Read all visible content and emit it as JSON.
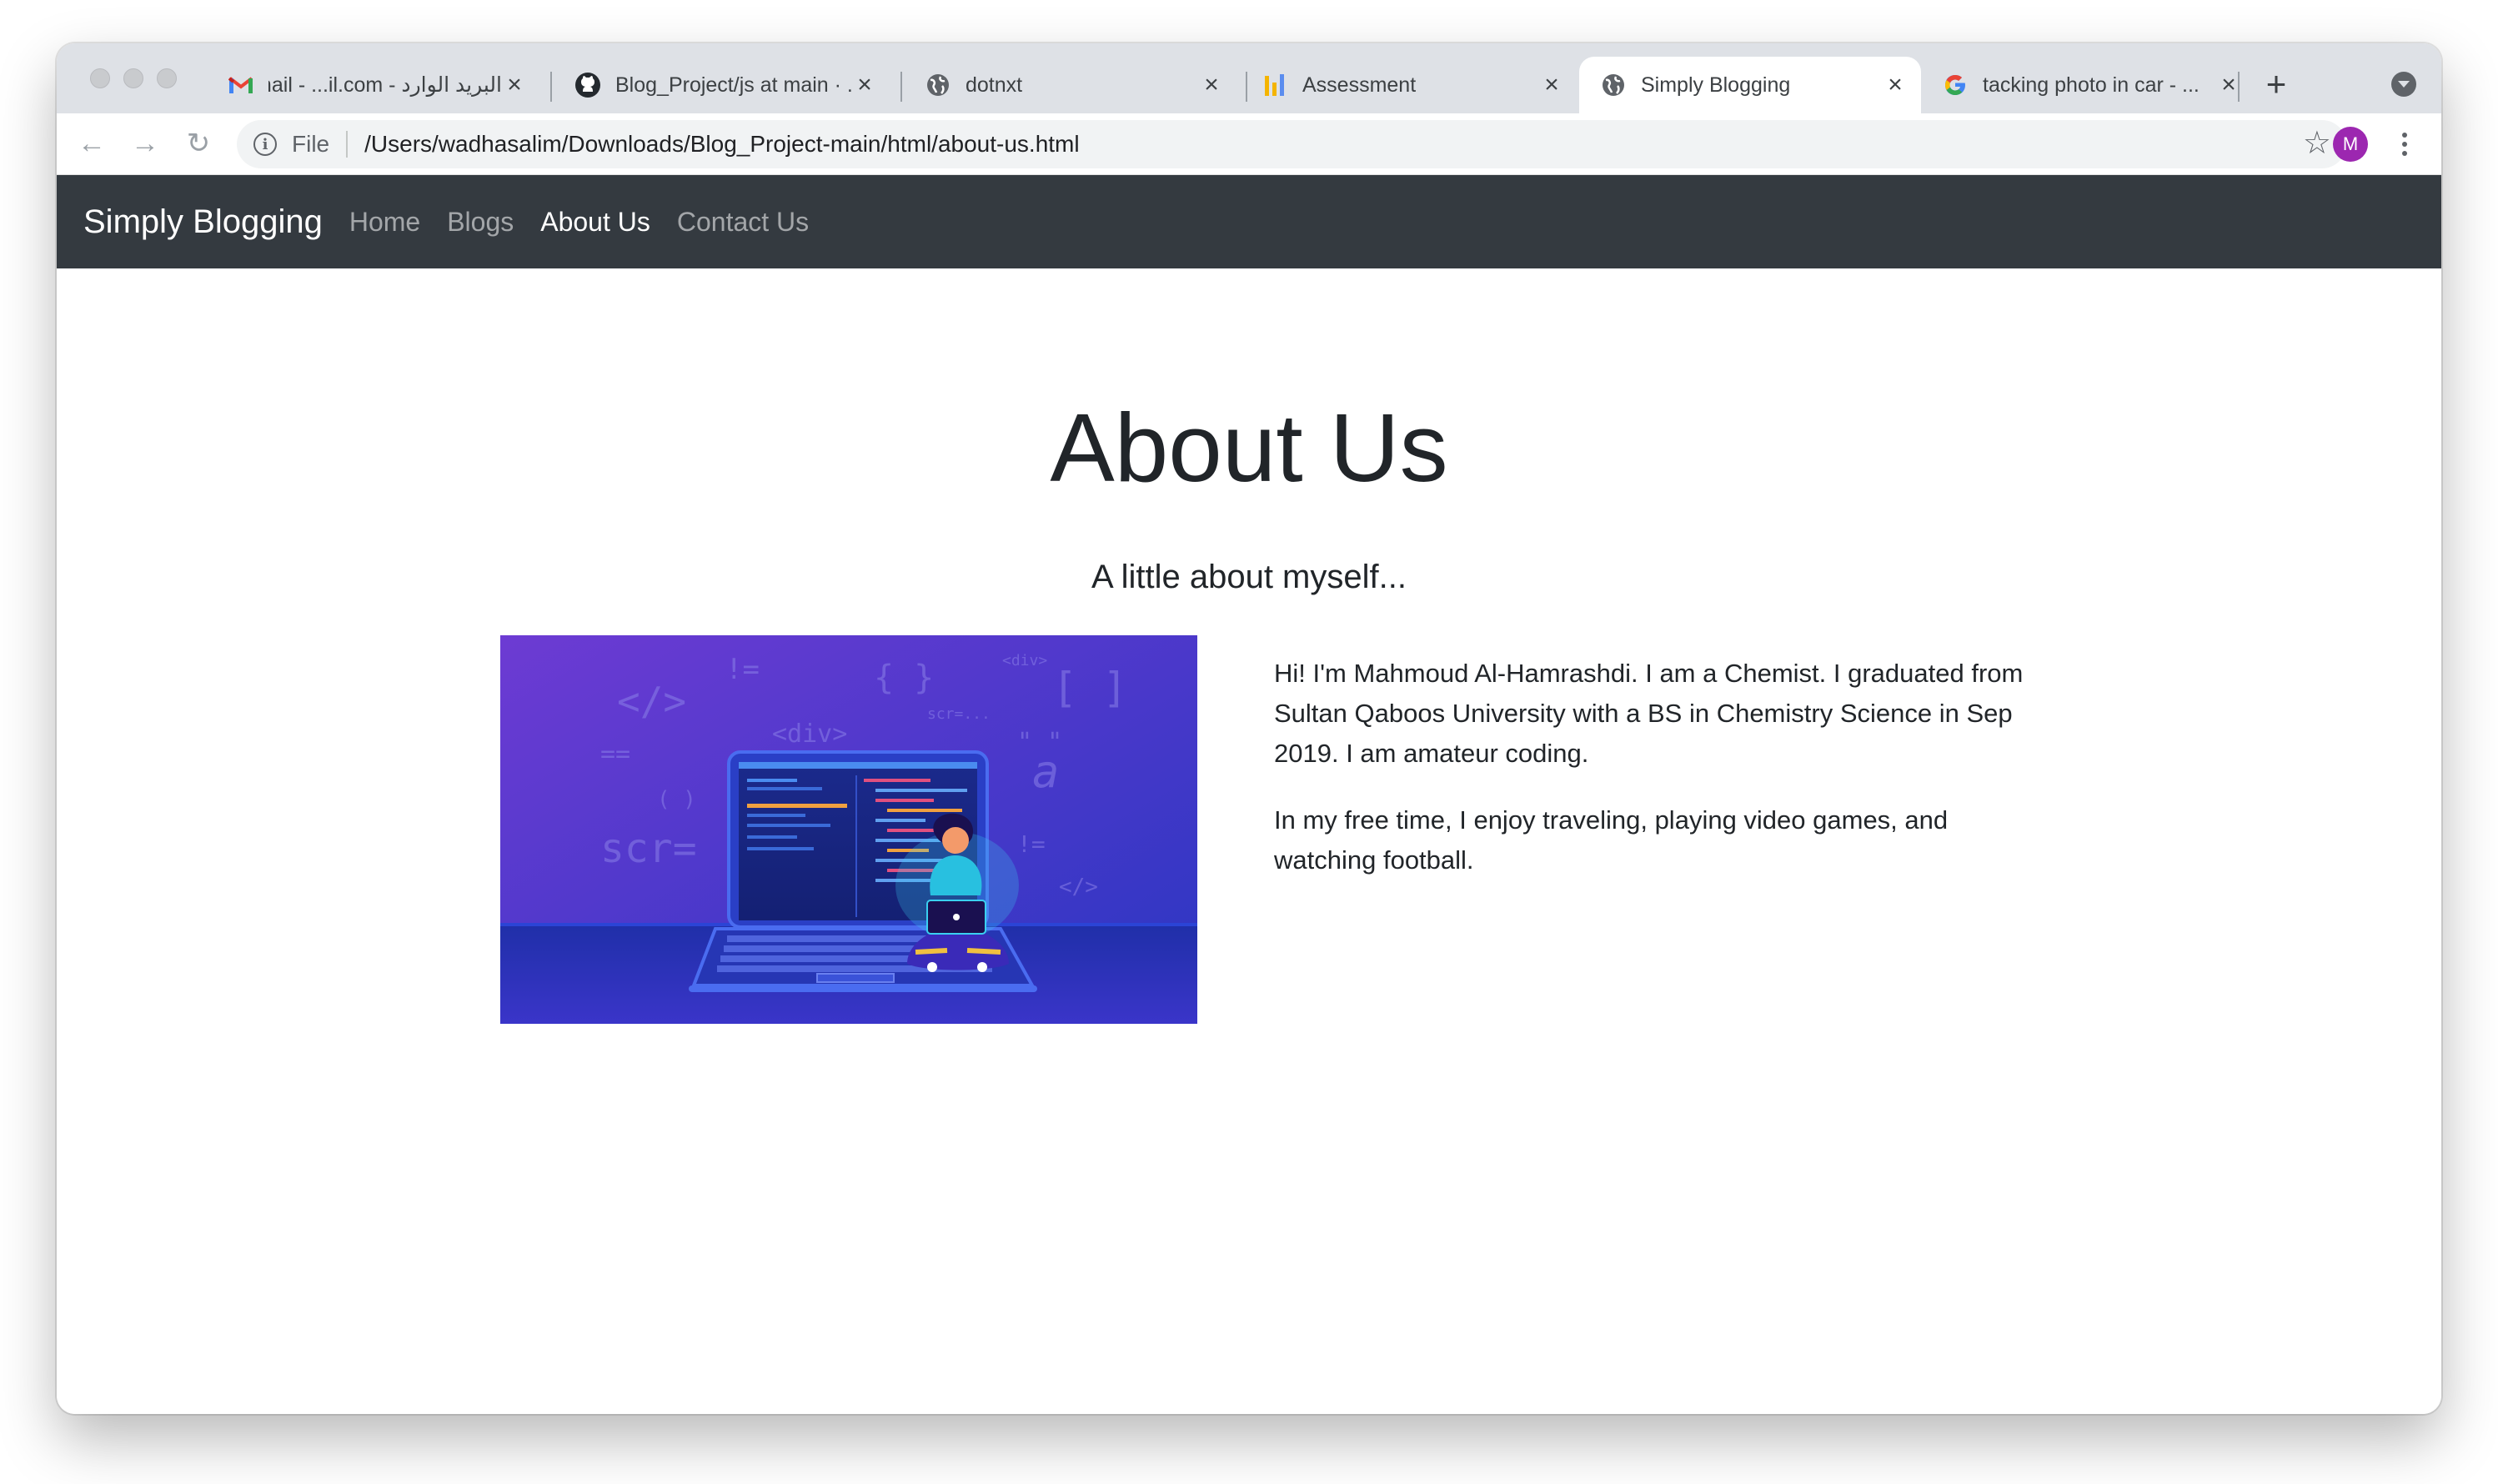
{
  "browser": {
    "tabs": [
      {
        "title": "البريد الوارد - Gmail - ...il.com",
        "icon": "gmail-icon"
      },
      {
        "title": "Blog_Project/js at main · ...",
        "icon": "github-icon"
      },
      {
        "title": "dotnxt",
        "icon": "globe-icon"
      },
      {
        "title": "Assessment",
        "icon": "assessment-icon"
      },
      {
        "title": "Simply Blogging",
        "icon": "globe-icon",
        "active": true
      },
      {
        "title": "tacking photo in car - ...",
        "icon": "google-icon"
      }
    ],
    "address": {
      "scheme_label": "File",
      "url": "/Users/wadhasalim/Downloads/Blog_Project-main/html/about-us.html"
    },
    "avatar_letter": "M"
  },
  "navbar": {
    "brand": "Simply Blogging",
    "links": [
      {
        "label": "Home",
        "active": false
      },
      {
        "label": "Blogs",
        "active": false
      },
      {
        "label": "About Us",
        "active": true
      },
      {
        "label": "Contact Us",
        "active": false
      }
    ]
  },
  "main": {
    "title": "About Us",
    "subtitle": "A little about myself...",
    "paragraphs": [
      "Hi! I'm Mahmoud Al-Hamrashdi. I am a Chemist. I graduated from Sultan Qaboos University with a BS in Chemistry Science in Sep 2019. I am amateur coding.",
      "In my free time, I enjoy traveling, playing video games, and watching football."
    ],
    "illustration_code_glyphs": [
      "</>",
      "!=",
      "{ }",
      "<div>",
      "[ ]",
      "scr=...",
      "<div>",
      "==",
      "( )",
      "scr=",
      "\" \"",
      "!=",
      "</>",
      "a"
    ]
  },
  "colors": {
    "navbar_bg": "#343a40",
    "tabstrip_bg": "#dee1e6",
    "illustration_top": "#6a3bd1",
    "illustration_bottom": "#2232b8"
  }
}
